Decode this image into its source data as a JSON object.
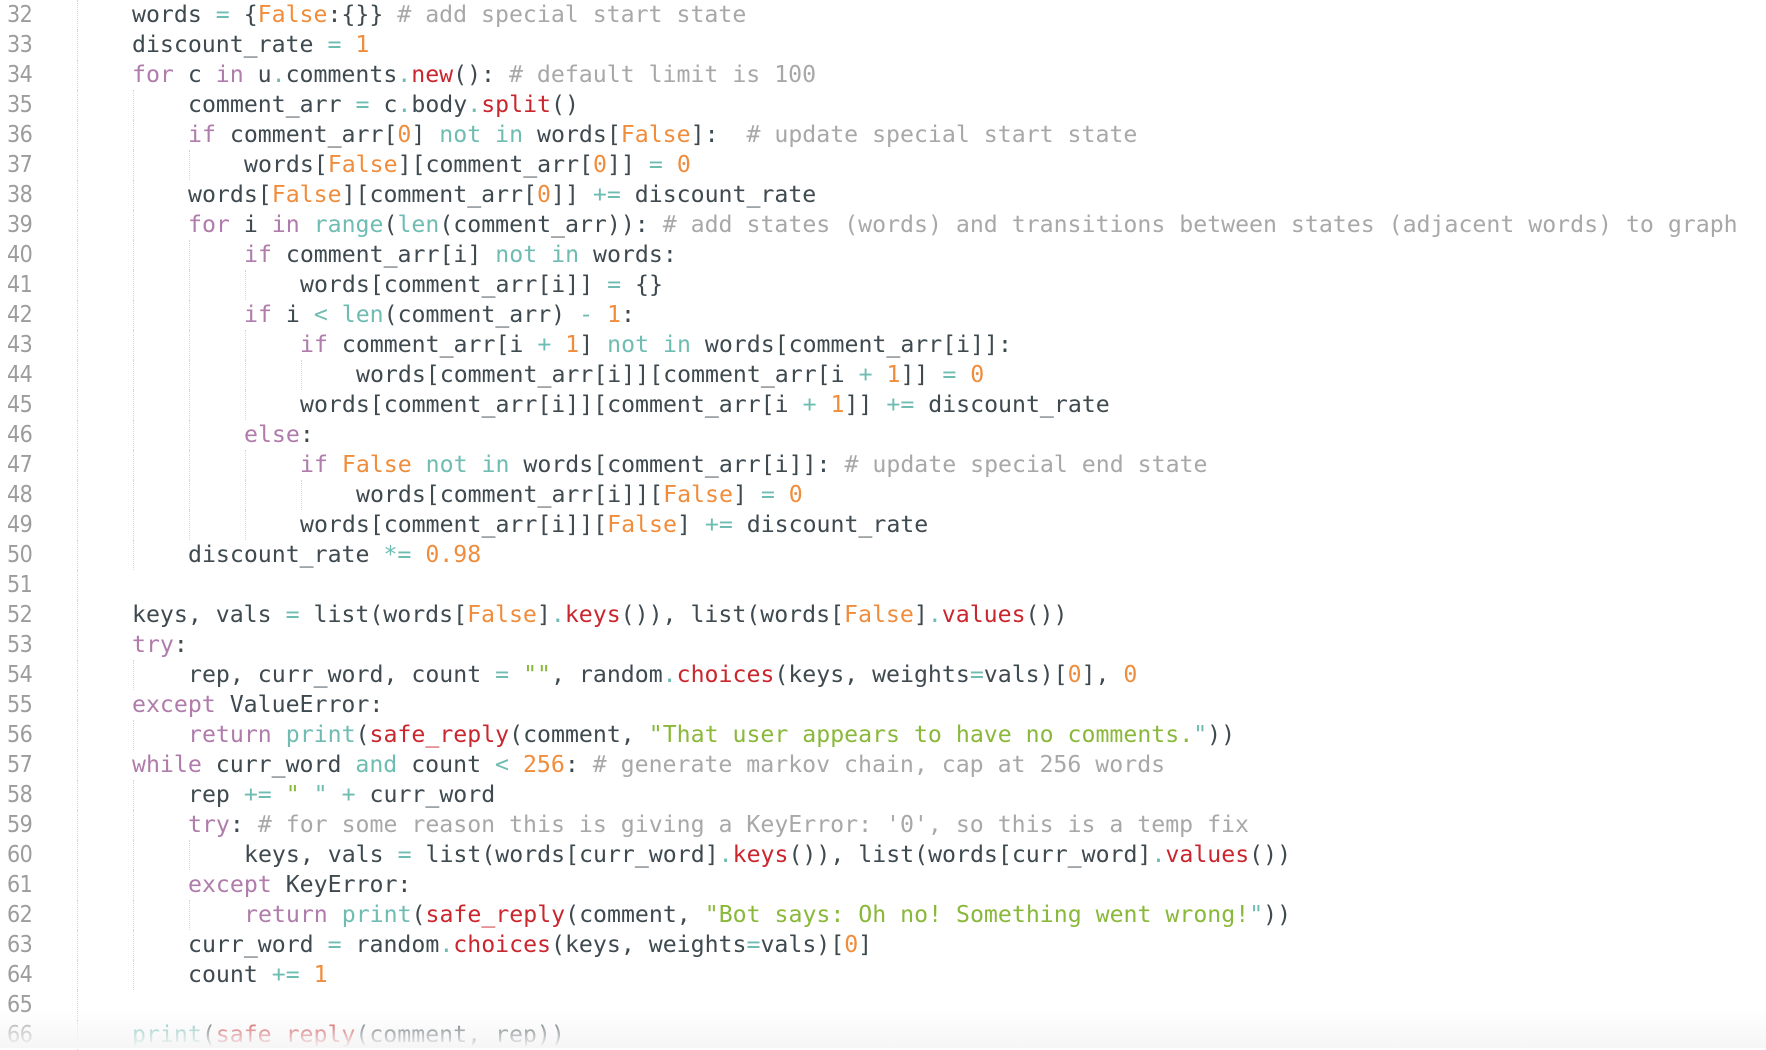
{
  "editor": {
    "colors": {
      "keyword": "#b07cab",
      "operator": "#6fbcb2",
      "builtin": "#6fbcb2",
      "function": "#c9262e",
      "number": "#f08d3c",
      "string": "#8ab83a",
      "comment": "#a8a8a8",
      "text": "#3e4a50",
      "line_number": "#9c9c9c",
      "background": "#ffffff"
    },
    "lines": [
      {
        "num": "32",
        "indent": 1,
        "tokens": [
          [
            "tx",
            "words "
          ],
          [
            "op",
            "="
          ],
          [
            "tx",
            " {"
          ],
          [
            "num",
            "False"
          ],
          [
            "tx",
            ":{}} "
          ],
          [
            "cm",
            "# add special start state"
          ]
        ]
      },
      {
        "num": "33",
        "indent": 1,
        "tokens": [
          [
            "tx",
            "discount_rate "
          ],
          [
            "op",
            "="
          ],
          [
            "tx",
            " "
          ],
          [
            "num",
            "1"
          ]
        ]
      },
      {
        "num": "34",
        "indent": 1,
        "tokens": [
          [
            "kw",
            "for"
          ],
          [
            "tx",
            " c "
          ],
          [
            "kw",
            "in"
          ],
          [
            "tx",
            " u"
          ],
          [
            "op",
            "."
          ],
          [
            "tx",
            "comments"
          ],
          [
            "op",
            "."
          ],
          [
            "fn",
            "new"
          ],
          [
            "tx",
            "(): "
          ],
          [
            "cm",
            "# default limit is 100"
          ]
        ]
      },
      {
        "num": "35",
        "indent": 2,
        "tokens": [
          [
            "tx",
            "comment_arr "
          ],
          [
            "op",
            "="
          ],
          [
            "tx",
            " c"
          ],
          [
            "op",
            "."
          ],
          [
            "tx",
            "body"
          ],
          [
            "op",
            "."
          ],
          [
            "fn",
            "split"
          ],
          [
            "tx",
            "()"
          ]
        ]
      },
      {
        "num": "36",
        "indent": 2,
        "tokens": [
          [
            "kw",
            "if"
          ],
          [
            "tx",
            " comment_arr["
          ],
          [
            "num",
            "0"
          ],
          [
            "tx",
            "] "
          ],
          [
            "op",
            "not in"
          ],
          [
            "tx",
            " words["
          ],
          [
            "num",
            "False"
          ],
          [
            "tx",
            "]:  "
          ],
          [
            "cm",
            "# update special start state"
          ]
        ]
      },
      {
        "num": "37",
        "indent": 3,
        "tokens": [
          [
            "tx",
            "words["
          ],
          [
            "num",
            "False"
          ],
          [
            "tx",
            "][comment_arr["
          ],
          [
            "num",
            "0"
          ],
          [
            "tx",
            "]] "
          ],
          [
            "op",
            "="
          ],
          [
            "tx",
            " "
          ],
          [
            "num",
            "0"
          ]
        ]
      },
      {
        "num": "38",
        "indent": 2,
        "tokens": [
          [
            "tx",
            "words["
          ],
          [
            "num",
            "False"
          ],
          [
            "tx",
            "][comment_arr["
          ],
          [
            "num",
            "0"
          ],
          [
            "tx",
            "]] "
          ],
          [
            "op",
            "+="
          ],
          [
            "tx",
            " discount_rate"
          ]
        ]
      },
      {
        "num": "39",
        "indent": 2,
        "tokens": [
          [
            "kw",
            "for"
          ],
          [
            "tx",
            " i "
          ],
          [
            "kw",
            "in"
          ],
          [
            "tx",
            " "
          ],
          [
            "bi",
            "range"
          ],
          [
            "tx",
            "("
          ],
          [
            "bi",
            "len"
          ],
          [
            "tx",
            "(comment_arr)): "
          ],
          [
            "cm",
            "# add states (words) and transitions between states (adjacent words) to graph"
          ]
        ]
      },
      {
        "num": "40",
        "indent": 3,
        "tokens": [
          [
            "kw",
            "if"
          ],
          [
            "tx",
            " comment_arr[i] "
          ],
          [
            "op",
            "not in"
          ],
          [
            "tx",
            " words:"
          ]
        ]
      },
      {
        "num": "41",
        "indent": 4,
        "tokens": [
          [
            "tx",
            "words[comment_arr[i]] "
          ],
          [
            "op",
            "="
          ],
          [
            "tx",
            " {}"
          ]
        ]
      },
      {
        "num": "42",
        "indent": 3,
        "tokens": [
          [
            "kw",
            "if"
          ],
          [
            "tx",
            " i "
          ],
          [
            "op",
            "<"
          ],
          [
            "tx",
            " "
          ],
          [
            "bi",
            "len"
          ],
          [
            "tx",
            "(comment_arr) "
          ],
          [
            "op",
            "-"
          ],
          [
            "tx",
            " "
          ],
          [
            "num",
            "1"
          ],
          [
            "tx",
            ":"
          ]
        ]
      },
      {
        "num": "43",
        "indent": 4,
        "tokens": [
          [
            "kw",
            "if"
          ],
          [
            "tx",
            " comment_arr[i "
          ],
          [
            "op",
            "+"
          ],
          [
            "tx",
            " "
          ],
          [
            "num",
            "1"
          ],
          [
            "tx",
            "] "
          ],
          [
            "op",
            "not in"
          ],
          [
            "tx",
            " words[comment_arr[i]]:"
          ]
        ]
      },
      {
        "num": "44",
        "indent": 5,
        "tokens": [
          [
            "tx",
            "words[comment_arr[i]][comment_arr[i "
          ],
          [
            "op",
            "+"
          ],
          [
            "tx",
            " "
          ],
          [
            "num",
            "1"
          ],
          [
            "tx",
            "]] "
          ],
          [
            "op",
            "="
          ],
          [
            "tx",
            " "
          ],
          [
            "num",
            "0"
          ]
        ]
      },
      {
        "num": "45",
        "indent": 4,
        "tokens": [
          [
            "tx",
            "words[comment_arr[i]][comment_arr[i "
          ],
          [
            "op",
            "+"
          ],
          [
            "tx",
            " "
          ],
          [
            "num",
            "1"
          ],
          [
            "tx",
            "]] "
          ],
          [
            "op",
            "+="
          ],
          [
            "tx",
            " discount_rate"
          ]
        ]
      },
      {
        "num": "46",
        "indent": 3,
        "tokens": [
          [
            "kw",
            "else"
          ],
          [
            "tx",
            ":"
          ]
        ]
      },
      {
        "num": "47",
        "indent": 4,
        "tokens": [
          [
            "kw",
            "if"
          ],
          [
            "tx",
            " "
          ],
          [
            "num",
            "False"
          ],
          [
            "tx",
            " "
          ],
          [
            "op",
            "not in"
          ],
          [
            "tx",
            " words[comment_arr[i]]: "
          ],
          [
            "cm",
            "# update special end state"
          ]
        ]
      },
      {
        "num": "48",
        "indent": 5,
        "tokens": [
          [
            "tx",
            "words[comment_arr[i]]["
          ],
          [
            "num",
            "False"
          ],
          [
            "tx",
            "] "
          ],
          [
            "op",
            "="
          ],
          [
            "tx",
            " "
          ],
          [
            "num",
            "0"
          ]
        ]
      },
      {
        "num": "49",
        "indent": 4,
        "tokens": [
          [
            "tx",
            "words[comment_arr[i]]["
          ],
          [
            "num",
            "False"
          ],
          [
            "tx",
            "] "
          ],
          [
            "op",
            "+="
          ],
          [
            "tx",
            " discount_rate"
          ]
        ]
      },
      {
        "num": "50",
        "indent": 2,
        "tokens": [
          [
            "tx",
            "discount_rate "
          ],
          [
            "op",
            "*="
          ],
          [
            "tx",
            " "
          ],
          [
            "num",
            "0.98"
          ]
        ]
      },
      {
        "num": "51",
        "indent": 1,
        "tokens": []
      },
      {
        "num": "52",
        "indent": 1,
        "tokens": [
          [
            "tx",
            "keys, vals "
          ],
          [
            "op",
            "="
          ],
          [
            "tx",
            " list(words["
          ],
          [
            "num",
            "False"
          ],
          [
            "tx",
            "]"
          ],
          [
            "op",
            "."
          ],
          [
            "fn",
            "keys"
          ],
          [
            "tx",
            "()), list(words["
          ],
          [
            "num",
            "False"
          ],
          [
            "tx",
            "]"
          ],
          [
            "op",
            "."
          ],
          [
            "fn",
            "values"
          ],
          [
            "tx",
            "())"
          ]
        ]
      },
      {
        "num": "53",
        "indent": 1,
        "tokens": [
          [
            "kw",
            "try"
          ],
          [
            "tx",
            ":"
          ]
        ]
      },
      {
        "num": "54",
        "indent": 2,
        "tokens": [
          [
            "tx",
            "rep, curr_word, count "
          ],
          [
            "op",
            "="
          ],
          [
            "tx",
            " "
          ],
          [
            "str",
            "\"\""
          ],
          [
            "tx",
            ", random"
          ],
          [
            "op",
            "."
          ],
          [
            "fn",
            "choices"
          ],
          [
            "tx",
            "(keys, weights"
          ],
          [
            "op",
            "="
          ],
          [
            "tx",
            "vals)["
          ],
          [
            "num",
            "0"
          ],
          [
            "tx",
            "], "
          ],
          [
            "num",
            "0"
          ]
        ]
      },
      {
        "num": "55",
        "indent": 1,
        "tokens": [
          [
            "kw",
            "except"
          ],
          [
            "tx",
            " ValueError:"
          ]
        ]
      },
      {
        "num": "56",
        "indent": 2,
        "tokens": [
          [
            "kw",
            "return"
          ],
          [
            "tx",
            " "
          ],
          [
            "bi",
            "print"
          ],
          [
            "tx",
            "("
          ],
          [
            "fn",
            "safe_reply"
          ],
          [
            "tx",
            "(comment, "
          ],
          [
            "str",
            "\"That user appears to have no comments."
          ],
          [
            "q",
            "\""
          ],
          [
            "tx",
            "))"
          ]
        ]
      },
      {
        "num": "57",
        "indent": 1,
        "tokens": [
          [
            "kw",
            "while"
          ],
          [
            "tx",
            " curr_word "
          ],
          [
            "op",
            "and"
          ],
          [
            "tx",
            " count "
          ],
          [
            "op",
            "<"
          ],
          [
            "tx",
            " "
          ],
          [
            "num",
            "256"
          ],
          [
            "tx",
            ": "
          ],
          [
            "cm",
            "# generate markov chain, cap at 256 words"
          ]
        ]
      },
      {
        "num": "58",
        "indent": 2,
        "tokens": [
          [
            "tx",
            "rep "
          ],
          [
            "op",
            "+="
          ],
          [
            "tx",
            " "
          ],
          [
            "str",
            "\" "
          ],
          [
            "q",
            "\""
          ],
          [
            "tx",
            " "
          ],
          [
            "op",
            "+"
          ],
          [
            "tx",
            " curr_word"
          ]
        ]
      },
      {
        "num": "59",
        "indent": 2,
        "tokens": [
          [
            "kw",
            "try"
          ],
          [
            "tx",
            ": "
          ],
          [
            "cm",
            "# for some reason this is giving a KeyError: '0', so this is a temp fix"
          ]
        ]
      },
      {
        "num": "60",
        "indent": 3,
        "tokens": [
          [
            "tx",
            "keys, vals "
          ],
          [
            "op",
            "="
          ],
          [
            "tx",
            " list(words[curr_word]"
          ],
          [
            "op",
            "."
          ],
          [
            "fn",
            "keys"
          ],
          [
            "tx",
            "()), list(words[curr_word]"
          ],
          [
            "op",
            "."
          ],
          [
            "fn",
            "values"
          ],
          [
            "tx",
            "())"
          ]
        ]
      },
      {
        "num": "61",
        "indent": 2,
        "tokens": [
          [
            "kw",
            "except"
          ],
          [
            "tx",
            " KeyError:"
          ]
        ]
      },
      {
        "num": "62",
        "indent": 3,
        "tokens": [
          [
            "kw",
            "return"
          ],
          [
            "tx",
            " "
          ],
          [
            "bi",
            "print"
          ],
          [
            "tx",
            "("
          ],
          [
            "fn",
            "safe_reply"
          ],
          [
            "tx",
            "(comment, "
          ],
          [
            "str",
            "\"Bot says: Oh no! Something went wrong!"
          ],
          [
            "q",
            "\""
          ],
          [
            "tx",
            "))"
          ]
        ]
      },
      {
        "num": "63",
        "indent": 2,
        "tokens": [
          [
            "tx",
            "curr_word "
          ],
          [
            "op",
            "="
          ],
          [
            "tx",
            " random"
          ],
          [
            "op",
            "."
          ],
          [
            "fn",
            "choices"
          ],
          [
            "tx",
            "(keys, weights"
          ],
          [
            "op",
            "="
          ],
          [
            "tx",
            "vals)["
          ],
          [
            "num",
            "0"
          ],
          [
            "tx",
            "]"
          ]
        ]
      },
      {
        "num": "64",
        "indent": 2,
        "tokens": [
          [
            "tx",
            "count "
          ],
          [
            "op",
            "+="
          ],
          [
            "tx",
            " "
          ],
          [
            "num",
            "1"
          ]
        ]
      },
      {
        "num": "65",
        "indent": 1,
        "tokens": []
      },
      {
        "num": "66",
        "indent": 1,
        "tokens": [
          [
            "bi",
            "print"
          ],
          [
            "tx",
            "("
          ],
          [
            "fn",
            "safe_reply"
          ],
          [
            "tx",
            "(comment, rep))"
          ]
        ]
      }
    ]
  }
}
